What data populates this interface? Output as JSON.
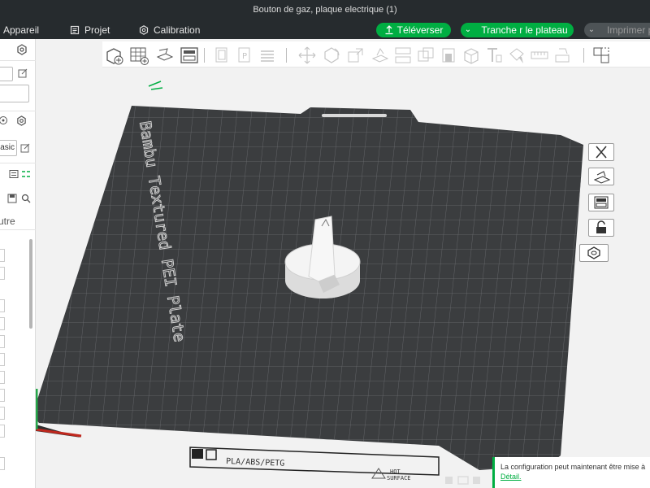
{
  "window": {
    "title": "Bouton de gaz, plaque electrique (1)"
  },
  "menu": {
    "device": "Appareil",
    "project": "Projet",
    "calibration": "Calibration"
  },
  "actions": {
    "upload": "Téléverser",
    "slice": "Tranche r le plateau",
    "print": "Imprimer p"
  },
  "sidebar": {
    "preset_suffix": "asic",
    "tab_other": "utre"
  },
  "plate": {
    "name": "Bambu Textured PEI Plate",
    "filament_label": "PLA/ABS/PETG",
    "surface_label_1": "HOT",
    "surface_label_2": "SURFACE"
  },
  "notification": {
    "message": "La configuration peut maintenant être mise à",
    "link": "Détail."
  },
  "colors": {
    "accent": "#00ae42",
    "titlebar": "#262b2e",
    "plate": "#3b3d3f"
  }
}
